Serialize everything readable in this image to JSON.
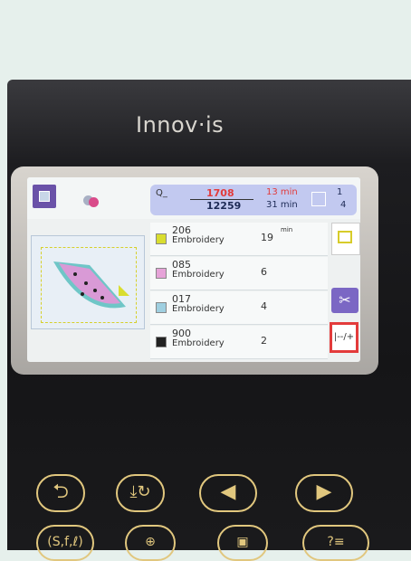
{
  "machine": {
    "brand": "Innov·is"
  },
  "status_bar": {
    "needle_icon": "needle-icon",
    "stitch_count_done": "1708",
    "stitch_count_total": "12259",
    "time_done": "13 min",
    "time_total": "31 min",
    "page_current": "1",
    "page_total": "4"
  },
  "colors": [
    {
      "code": "206",
      "name": "Embroidery",
      "time": "19",
      "unit": "min",
      "swatch": "#d9dd2f"
    },
    {
      "code": "085",
      "name": "Embroidery",
      "time": "6",
      "unit": "",
      "swatch": "#e6a3d8"
    },
    {
      "code": "017",
      "name": "Embroidery",
      "time": "4",
      "unit": "",
      "swatch": "#9fcfe0"
    },
    {
      "code": "900",
      "name": "Embroidery",
      "time": "2",
      "unit": "",
      "swatch": "#222222"
    }
  ],
  "tools": {
    "frame_icon": "embroidery-frame-icon",
    "scissors_icon": "thread-cut-icon",
    "tension_label": "|--/+"
  },
  "keys": {
    "back": "⮌",
    "auto_lock": "⤓↻",
    "left": "◀",
    "right": "▶",
    "row2_a": "(S,f,ℓ)",
    "row2_b": "⊕",
    "row2_c": "▣",
    "row2_d": "?≡"
  },
  "accent_colors": {
    "ui_purple": "#6a52a8",
    "highlight_red": "#e33b3b",
    "key_gold": "#e1c77e"
  }
}
